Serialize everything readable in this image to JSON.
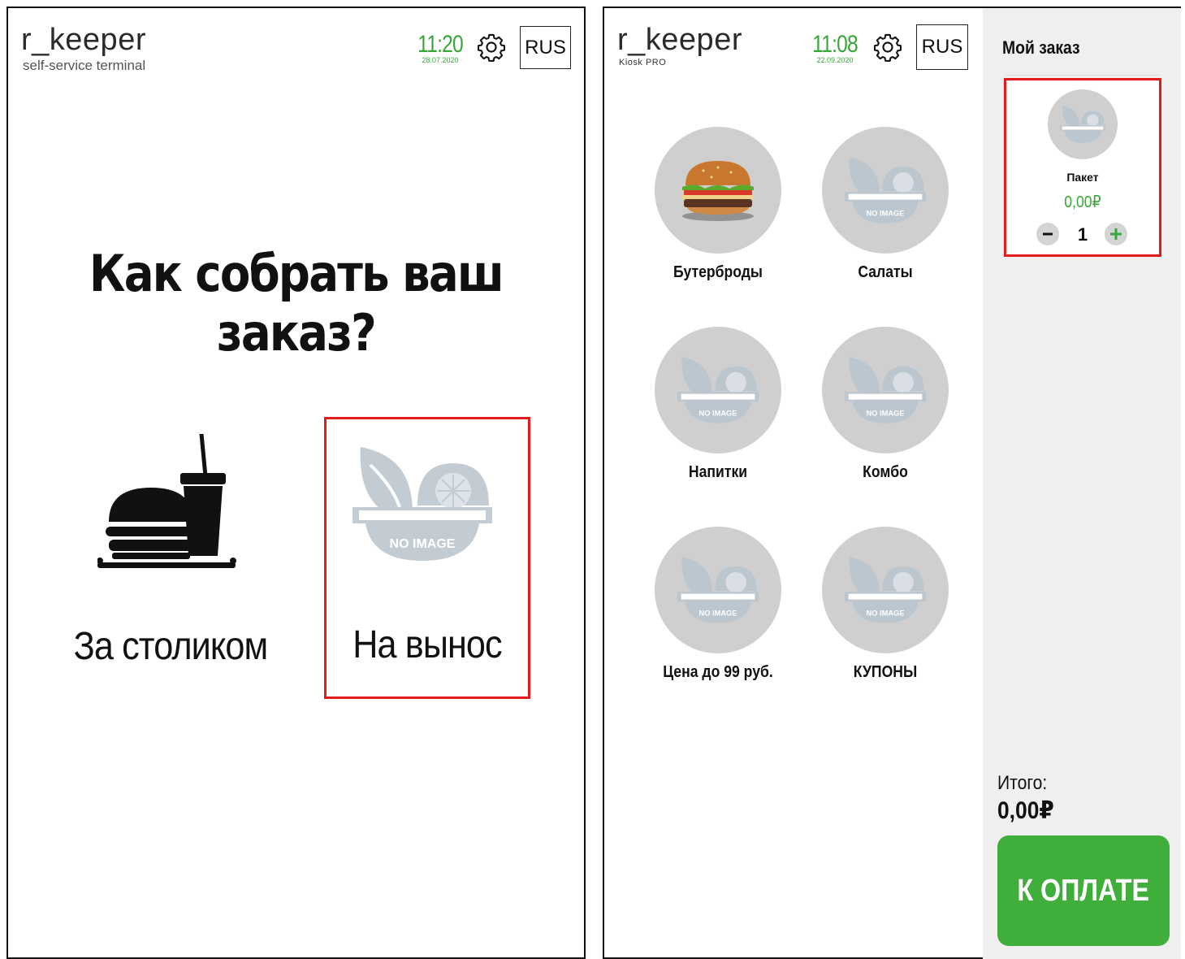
{
  "screen_a": {
    "logo": {
      "main": "r_keeper",
      "sub": "self-service terminal"
    },
    "clock": {
      "time": "11:20",
      "date": "28.07.2020"
    },
    "language_button": "RUS",
    "title": "Как собрать ваш заказ?",
    "options": [
      {
        "label": "За столиком",
        "icon": "burger-drink-icon"
      },
      {
        "label": "На вынос",
        "icon": "no-image-icon",
        "image_text": "NO IMAGE"
      }
    ]
  },
  "screen_b": {
    "logo": {
      "main": "r_keeper",
      "sub": "Kiosk PRO"
    },
    "clock": {
      "time": "11:08",
      "date": "22.09.2020"
    },
    "language_button": "RUS",
    "categories": [
      {
        "label": "Бутерброды",
        "icon": "burger-icon"
      },
      {
        "label": "Салаты",
        "icon": "no-image-icon"
      },
      {
        "label": "Напитки",
        "icon": "no-image-icon"
      },
      {
        "label": "Комбо",
        "icon": "no-image-icon"
      },
      {
        "label": "Цена до 99 руб.",
        "icon": "no-image-icon"
      },
      {
        "label": "КУПОНЫ",
        "icon": "no-image-icon"
      }
    ],
    "no_image_text": "NO IMAGE",
    "order": {
      "title": "Мой заказ",
      "item": {
        "name": "Пакет",
        "price": "0,00₽",
        "quantity": "1"
      },
      "total_label": "Итого:",
      "total_value": "0,00₽",
      "pay_button": "К ОПЛАТЕ"
    }
  },
  "colors": {
    "accent_green": "#3fae3a",
    "clock_green": "#3aa63a",
    "highlight_red": "#e31b1b",
    "placeholder_gray": "#cfcfcf"
  }
}
